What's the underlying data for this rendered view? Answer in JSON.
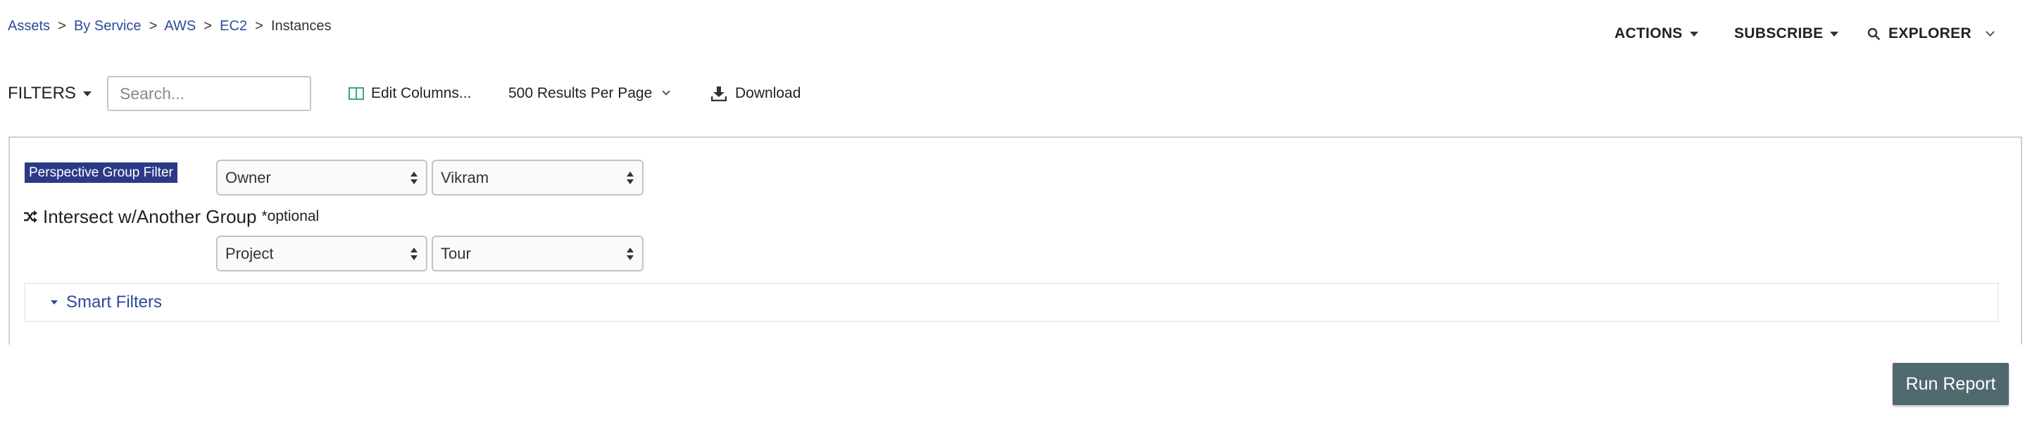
{
  "breadcrumb": {
    "items": [
      "Assets",
      "By Service",
      "AWS",
      "EC2"
    ],
    "separator": ">",
    "current": "Instances"
  },
  "topnav": {
    "actions_label": "ACTIONS",
    "subscribe_label": "SUBSCRIBE",
    "explorer_label": "EXPLORER"
  },
  "toolbar": {
    "filters_label": "FILTERS",
    "search_placeholder": "Search...",
    "edit_columns_label": "Edit Columns...",
    "results_per_page_label": "500 Results Per Page",
    "download_label": "Download"
  },
  "filter_panel": {
    "perspective_badge": "Perspective Group Filter",
    "group_select_value": "Owner",
    "group_value_select_value": "Vikram",
    "intersect_label": "Intersect w/Another Group",
    "optional_label": "*optional",
    "intersect_group_select_value": "Project",
    "intersect_value_select_value": "Tour",
    "smart_filters_label": "Smart Filters"
  },
  "run_report_label": "Run Report",
  "colors": {
    "link": "#2d4a9b",
    "badge_bg": "#2b3a87",
    "run_report_bg": "#50696e",
    "columns_icon": "#3aa38a"
  },
  "icons": {
    "actions_caret": "caret-down-icon",
    "subscribe_caret": "caret-down-icon",
    "explorer_search": "search-icon",
    "explorer_chevron": "chevron-down-icon",
    "filters_caret": "caret-down-icon",
    "edit_columns": "columns-icon",
    "results_chevron": "chevron-down-icon",
    "download": "download-icon",
    "intersect": "shuffle-icon",
    "smart_filters": "caret-down-icon"
  }
}
